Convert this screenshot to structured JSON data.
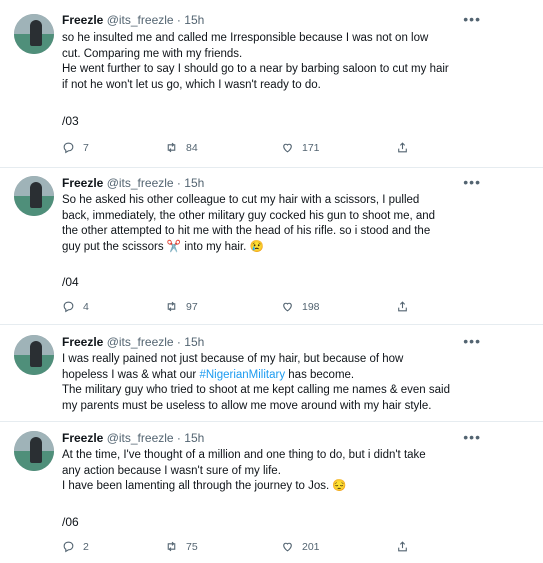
{
  "tweets": [
    {
      "name": "Freezle",
      "handle": "@its_freezle",
      "time": "15h",
      "more": "•••",
      "lines": [
        "so he insulted me and called me Irresponsible because I was not on low",
        "cut. Comparing me with my friends.",
        "He went further to say I should go to a near by barbing saloon to cut my hair",
        "if not he won't let us go, which I wasn't ready to do."
      ],
      "thread": "/03",
      "replies": "7",
      "retweets": "84",
      "likes": "171"
    },
    {
      "name": "Freezle",
      "handle": "@its_freezle",
      "time": "15h",
      "more": "•••",
      "lines": [
        "So he asked his other colleague to cut my hair with a scissors, I pulled",
        "back, immediately, the other military guy cocked his gun to shoot me, and",
        "the other attempted to hit me with the head of his rifle. so i stood and the",
        "guy put the scissors ✂️ into my hair. 😢"
      ],
      "thread": "/04",
      "replies": "4",
      "retweets": "97",
      "likes": "198"
    },
    {
      "name": "Freezle",
      "handle": "@its_freezle",
      "time": "15h",
      "more": "•••",
      "line1": "I was really pained not just because of my hair, but because of how",
      "line2_pre": "hopeless I was & what our ",
      "hashtag": "#NigerianMilitary",
      "line2_post": " has become.",
      "line3": "The military guy who tried to shoot at me kept calling me names & even said",
      "line4": "my parents must be useless to allow me move around with my hair style."
    },
    {
      "name": "Freezle",
      "handle": "@its_freezle",
      "time": "15h",
      "more": "•••",
      "lines": [
        "At the time, I've thought of a million and one thing to do, but i didn't take",
        "any action because I wasn't sure of my life.",
        "I have been lamenting all through the journey to Jos. 😔"
      ],
      "thread": "/06",
      "replies": "2",
      "retweets": "75",
      "likes": "201"
    }
  ],
  "colors": {
    "hashtag": "#1d9bf0",
    "muted": "#536471",
    "separator": "#e6ecf0"
  },
  "icons": [
    "reply-icon",
    "retweet-icon",
    "like-icon",
    "share-icon",
    "more-icon",
    "avatar"
  ]
}
